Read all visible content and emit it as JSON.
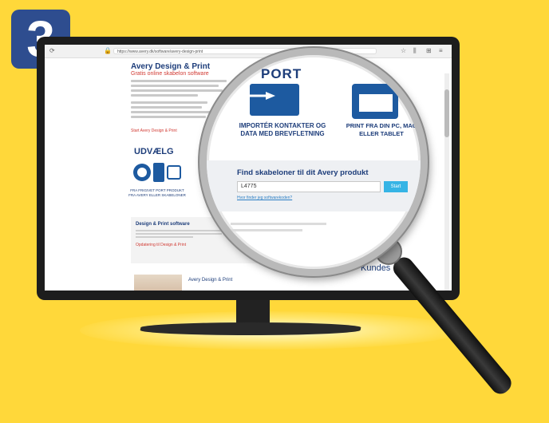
{
  "step_number": "3",
  "browser": {
    "url": "https://www.avery.dk/software/avery-design-print"
  },
  "page": {
    "title": "Avery Design & Print",
    "subtitle": "Gratis online skabelon software",
    "link": "Start Avery Design & Print",
    "udvaelg": "UDVÆLG",
    "udvaelg_caption": "FRA FRIGIVET PORT PRODUKT FRA AVERY ELLER SKABELONER",
    "design_print_title": "Design & Print software",
    "design_print_link": "Opdatering til Design & Print",
    "bottom_title": "Avery Design & Print",
    "kundeservice": "Kundes"
  },
  "magnifier": {
    "export_word": "PORT",
    "caption_left": "IMPORTÉR KONTAKTER OG DATA MED BREVFLETNING",
    "caption_right": "PRINT FRA DIN PC, MAC ELLER TABLET",
    "find_title": "Find skabeloner til dit Avery produkt",
    "input_value": "L4775",
    "button_label": "Start",
    "help_link": "Hvor finder jeg softwarekoden?"
  },
  "colors": {
    "background": "#ffd83a",
    "badge": "#2e4d8f",
    "brand_blue": "#1d3d7a",
    "accent_red": "#d13a33",
    "button": "#36b4e5"
  }
}
